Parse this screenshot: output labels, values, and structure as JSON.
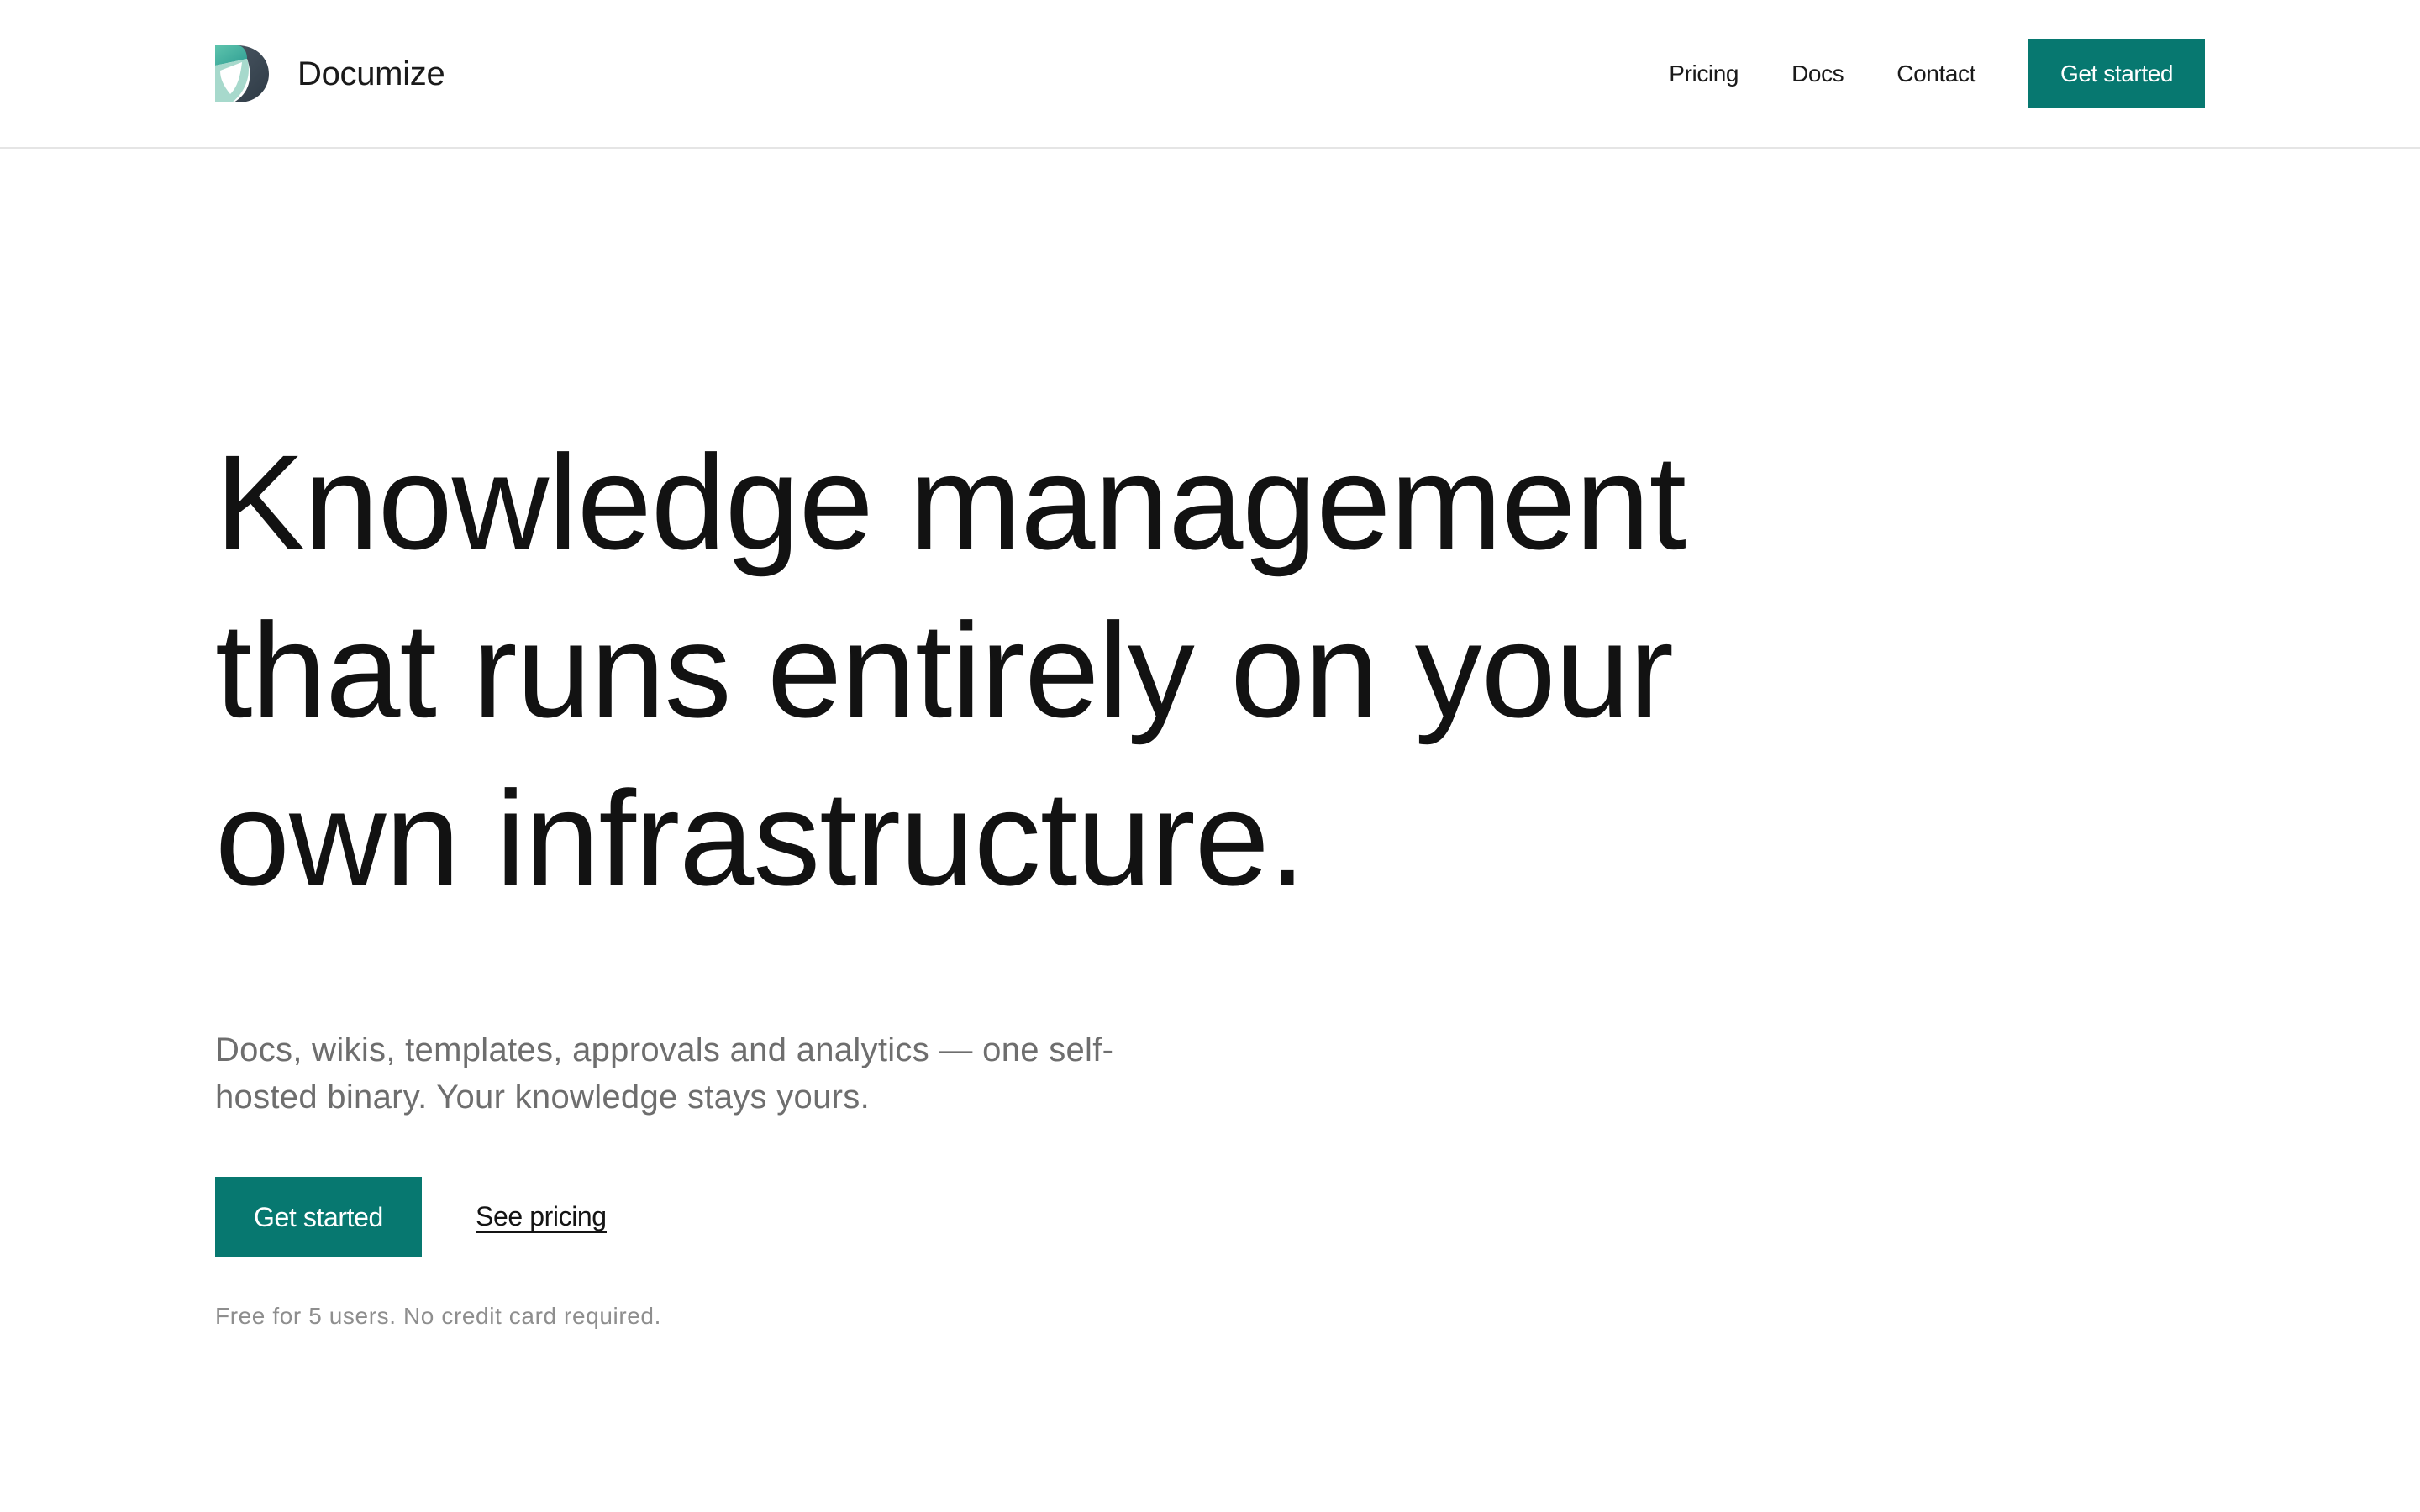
{
  "header": {
    "brand": {
      "name": "Documize",
      "logo_icon": "documize-logo-icon"
    },
    "nav": {
      "items": [
        {
          "label": "Pricing"
        },
        {
          "label": "Docs"
        },
        {
          "label": "Contact"
        }
      ],
      "cta_label": "Get started"
    }
  },
  "hero": {
    "title_lines": [
      "Knowledge management",
      "that runs entirely on your",
      "own infrastructure."
    ],
    "subtitle_lines": [
      "Docs, wikis, templates, approvals and analytics — one self-",
      "hosted binary. Your knowledge stays yours."
    ],
    "primary_cta": "Get started",
    "secondary_link": "See pricing",
    "fineprint": "Free for 5 users. No credit card required."
  },
  "colors": {
    "accent": "#077870",
    "text": "#141414",
    "muted": "#6e6e6e",
    "fineprint": "#8e8e8e",
    "divider": "#e5e5e5"
  }
}
